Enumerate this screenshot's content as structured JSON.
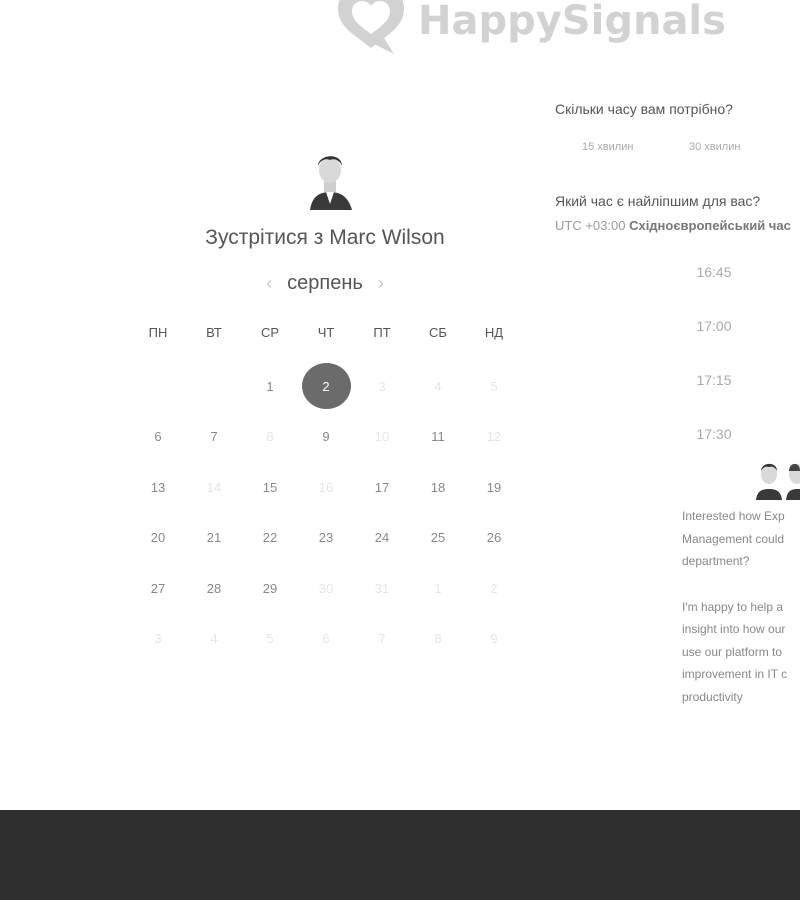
{
  "brand": {
    "name": "HappySignals",
    "logo_color": "#d2d2d2"
  },
  "booking": {
    "title": "Зустрітися з Marc Wilson",
    "month": "серпень",
    "prev_icon": "chevron-left-icon",
    "next_icon": "chevron-right-icon",
    "weekdays": [
      "ПН",
      "ВТ",
      "СР",
      "ЧТ",
      "ПТ",
      "СБ",
      "НД"
    ],
    "days": [
      "",
      "",
      "1",
      "2",
      "3",
      "4",
      "5",
      "6",
      "7",
      "8",
      "9",
      "10",
      "11",
      "12",
      "13",
      "14",
      "15",
      "16",
      "17",
      "18",
      "19",
      "20",
      "21",
      "22",
      "23",
      "24",
      "25",
      "26",
      "27",
      "28",
      "29",
      "30",
      "31",
      "1",
      "2",
      "3",
      "4",
      "5",
      "6",
      "7",
      "8",
      "9"
    ],
    "selected_day": "2"
  },
  "duration": {
    "question": "Скільки часу вам потрібно?",
    "options": [
      "15 хвилин",
      "30 хвилин"
    ]
  },
  "time": {
    "question": "Який час є найліпшим для вас?",
    "tz_offset": "UTC +03:00",
    "tz_name": "Східноєвропейський час",
    "slots": [
      "16:45",
      "17:00",
      "17:15",
      "17:30"
    ]
  },
  "description": {
    "lines1": [
      "Interested how Exp",
      "Management could",
      "department?"
    ],
    "lines2": [
      "I'm happy to help a",
      "insight into how our",
      "use our platform to",
      "improvement in IT c",
      "productivity"
    ]
  },
  "colors": {
    "selected": "#6b6b6b",
    "footer": "#2f2f2f"
  }
}
